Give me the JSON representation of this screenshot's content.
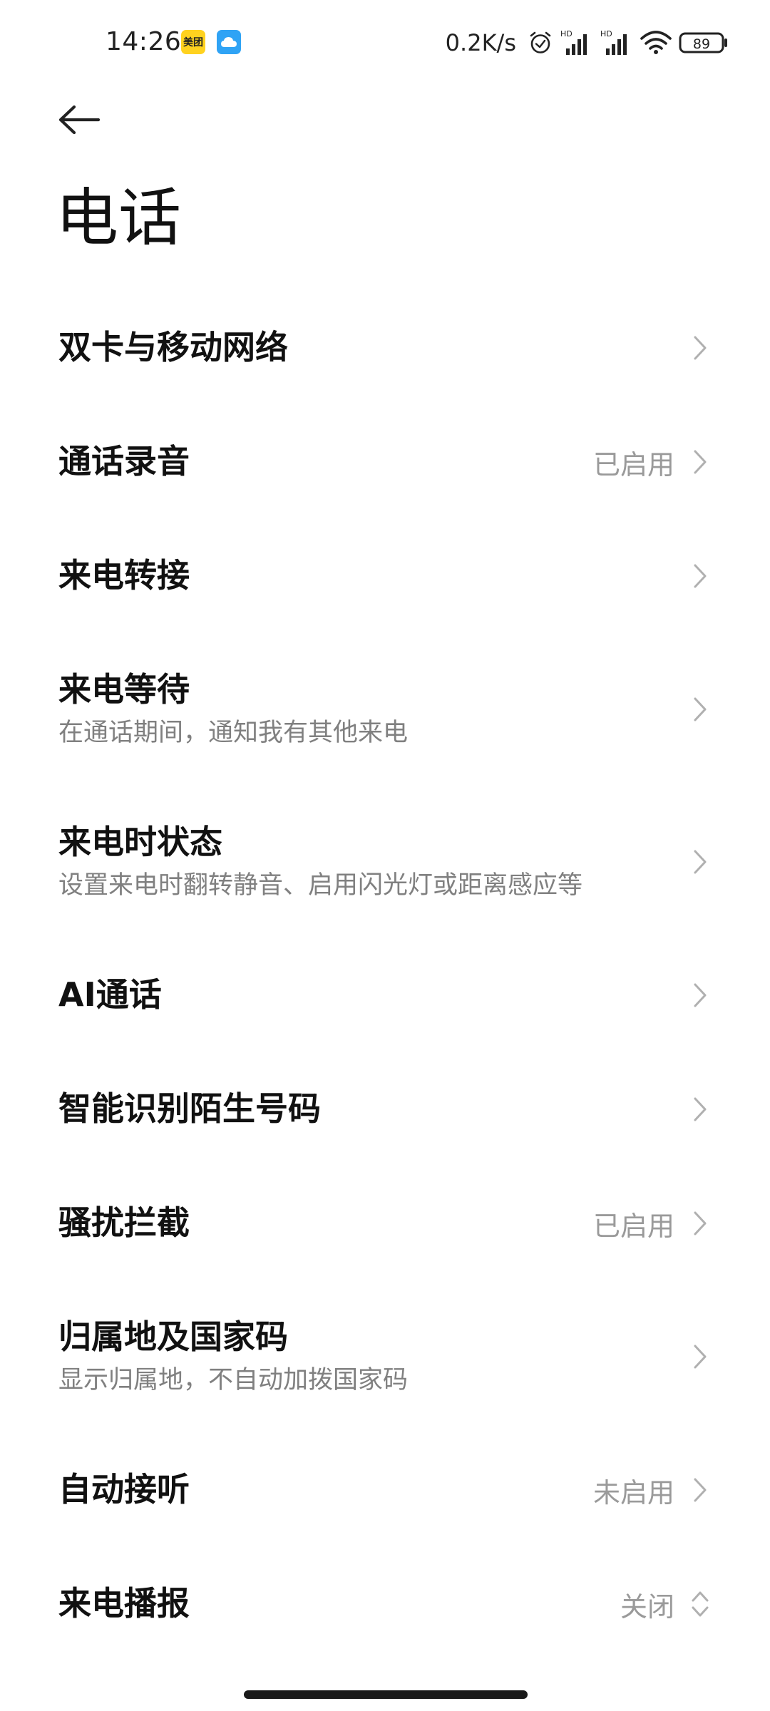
{
  "status_bar": {
    "time": "14:26",
    "meituan_label": "美团",
    "net_speed": "0.2K/s",
    "signal1_label": "HD",
    "signal2_label": "HD",
    "battery": "89",
    "icons": [
      "meituan-app-icon",
      "cloud-app-icon",
      "alarm-icon",
      "signal-icon",
      "signal-icon",
      "wifi-icon",
      "battery-icon"
    ]
  },
  "header": {
    "back_icon": "arrow-left-icon",
    "title": "电话"
  },
  "items": [
    {
      "title": "双卡与移动网络",
      "subtitle": "",
      "value": "",
      "control": "chevron-right-icon"
    },
    {
      "title": "通话录音",
      "subtitle": "",
      "value": "已启用",
      "control": "chevron-right-icon"
    },
    {
      "title": "来电转接",
      "subtitle": "",
      "value": "",
      "control": "chevron-right-icon"
    },
    {
      "title": "来电等待",
      "subtitle": "在通话期间，通知我有其他来电",
      "value": "",
      "control": "chevron-right-icon"
    },
    {
      "title": "来电时状态",
      "subtitle": "设置来电时翻转静音、启用闪光灯或距离感应等",
      "value": "",
      "control": "chevron-right-icon"
    },
    {
      "title": "AI通话",
      "subtitle": "",
      "value": "",
      "control": "chevron-right-icon"
    },
    {
      "title": "智能识别陌生号码",
      "subtitle": "",
      "value": "",
      "control": "chevron-right-icon"
    },
    {
      "title": "骚扰拦截",
      "subtitle": "",
      "value": "已启用",
      "control": "chevron-right-icon"
    },
    {
      "title": "归属地及国家码",
      "subtitle": "显示归属地，不自动加拨国家码",
      "value": "",
      "control": "chevron-right-icon"
    },
    {
      "title": "自动接听",
      "subtitle": "",
      "value": "未启用",
      "control": "chevron-right-icon"
    },
    {
      "title": "来电播报",
      "subtitle": "",
      "value": "关闭",
      "control": "chevron-up-down-icon"
    }
  ],
  "colors": {
    "title_text": "#111111",
    "subtitle_text": "#808080",
    "value_text": "#9a9a9a",
    "chevron": "#b0b0b0",
    "meituan_yellow": "#ffd21f",
    "cloud_blue": "#2fa3f5"
  }
}
